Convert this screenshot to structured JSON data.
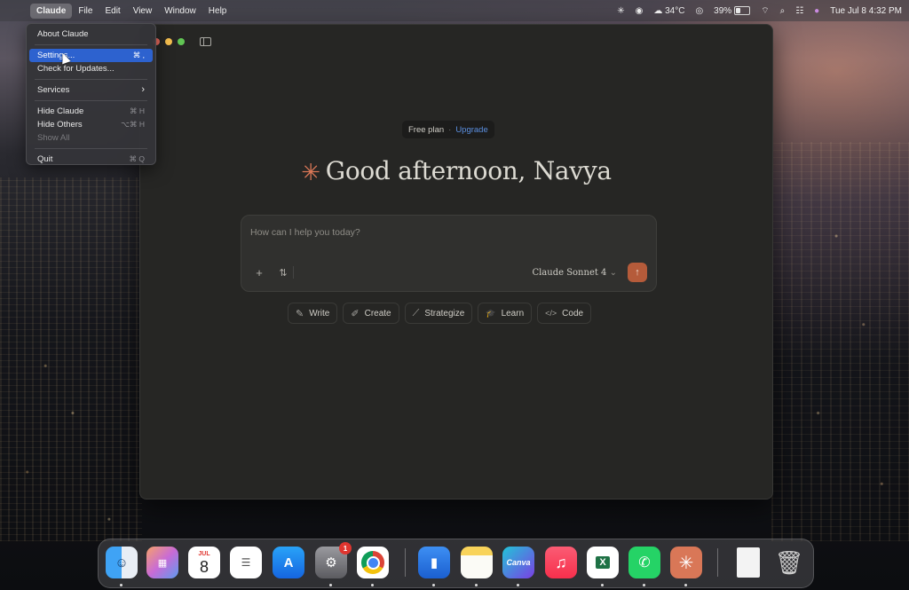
{
  "menubar": {
    "items": [
      "Claude",
      "File",
      "Edit",
      "View",
      "Window",
      "Help"
    ],
    "status": {
      "weather": "34°C",
      "battery": "39%",
      "battery_level": 0.39,
      "datetime": "Tue Jul 8  4:32 PM"
    }
  },
  "dropdown": {
    "about": "About Claude",
    "settings": "Settings...",
    "settings_shortcut": "⌘ ,",
    "updates": "Check for Updates...",
    "services": "Services",
    "services_arrow": "›",
    "hide": "Hide Claude",
    "hide_shortcut": "⌘ H",
    "hide_others": "Hide Others",
    "hide_others_shortcut": "⌥⌘ H",
    "show_all": "Show All",
    "quit": "Quit",
    "quit_shortcut": "⌘ Q"
  },
  "app": {
    "plan": "Free plan",
    "plan_sep": "·",
    "upgrade": "Upgrade",
    "greeting": "Good afternoon, Navya",
    "spark": "✳",
    "composer": {
      "placeholder": "How can I help you today?",
      "model": "Claude Sonnet 4",
      "model_caret": "⌄",
      "add": "+",
      "tools": "⇅",
      "send": "↑"
    },
    "chips": [
      {
        "icon": "✎",
        "label": "Write"
      },
      {
        "icon": "✐",
        "label": "Create"
      },
      {
        "icon": "⟋",
        "label": "Strategize"
      },
      {
        "icon": "🎓",
        "label": "Learn"
      },
      {
        "icon": "</>",
        "label": "Code"
      }
    ]
  },
  "dock": {
    "calendar_month": "JUL",
    "calendar_day": "8",
    "settings_badge": "1",
    "canva": "Canva",
    "excel": "X"
  },
  "colors": {
    "accent": "#d97757",
    "send": "#b55b3a",
    "link": "#5b8fe0",
    "menu_selected": "#2d62cf"
  }
}
